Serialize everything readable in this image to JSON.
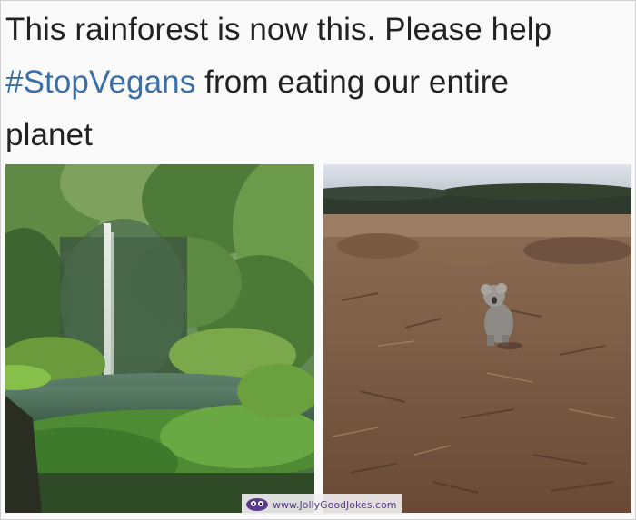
{
  "caption": {
    "line1": "This rainforest is now this. Please help",
    "hashtag": "#StopVegans",
    "line2_rest": " from eating our entire",
    "line3": "planet"
  },
  "images": {
    "left_icon": "rainforest-waterfall-photo",
    "right_icon": "deforested-land-koala-photo"
  },
  "watermark": {
    "text": "www.JollyGoodJokes.com",
    "icon": "jollygoodjokes-logo-icon"
  },
  "colors": {
    "hashtag": "#3a6fa8",
    "text": "#222222",
    "watermark": "#5b3a8c"
  }
}
